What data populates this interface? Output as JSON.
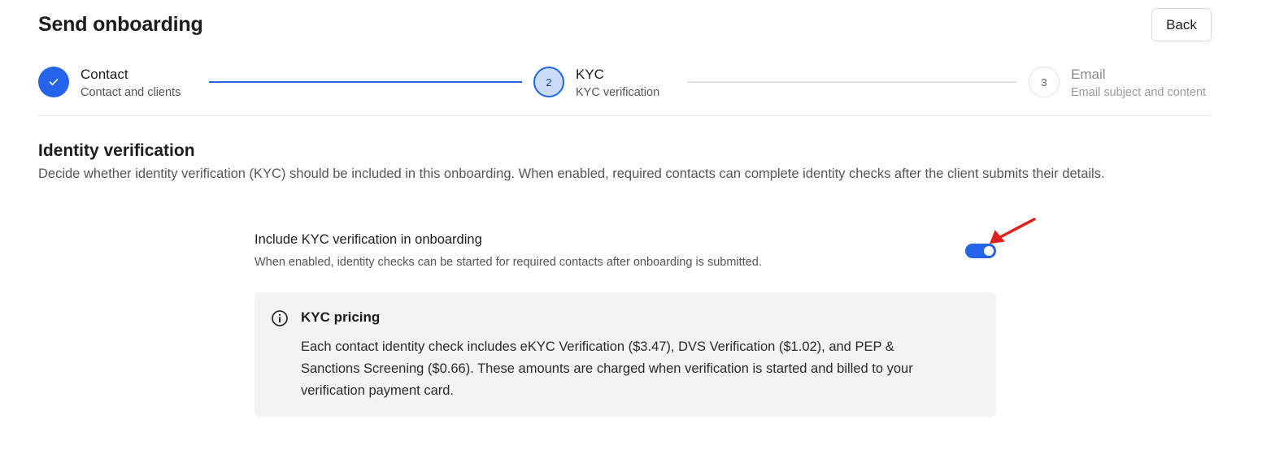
{
  "header": {
    "title": "Send onboarding",
    "back_label": "Back"
  },
  "stepper": {
    "steps": [
      {
        "number": "1",
        "title": "Contact",
        "subtitle": "Contact and clients",
        "state": "completed"
      },
      {
        "number": "2",
        "title": "KYC",
        "subtitle": "KYC verification",
        "state": "active"
      },
      {
        "number": "3",
        "title": "Email",
        "subtitle": "Email subject and content",
        "state": "upcoming"
      }
    ]
  },
  "section": {
    "title": "Identity verification",
    "description": "Decide whether identity verification (KYC) should be included in this onboarding. When enabled, required contacts can complete identity checks after the client submits their details."
  },
  "kyc_toggle": {
    "label": "Include KYC verification in onboarding",
    "help": "When enabled, identity checks can be started for required contacts after onboarding is submitted.",
    "enabled": true
  },
  "pricing": {
    "title": "KYC pricing",
    "text": "Each contact identity check includes eKYC Verification ($3.47), DVS Verification ($1.02), and PEP & Sanctions Screening ($0.66). These amounts are charged when verification is started and billed to your verification payment card."
  },
  "colors": {
    "accent": "#2563eb",
    "active_step_fill": "#c9ddfb",
    "annotation_arrow": "#e02020",
    "pricing_bg": "#f3f3f3"
  }
}
